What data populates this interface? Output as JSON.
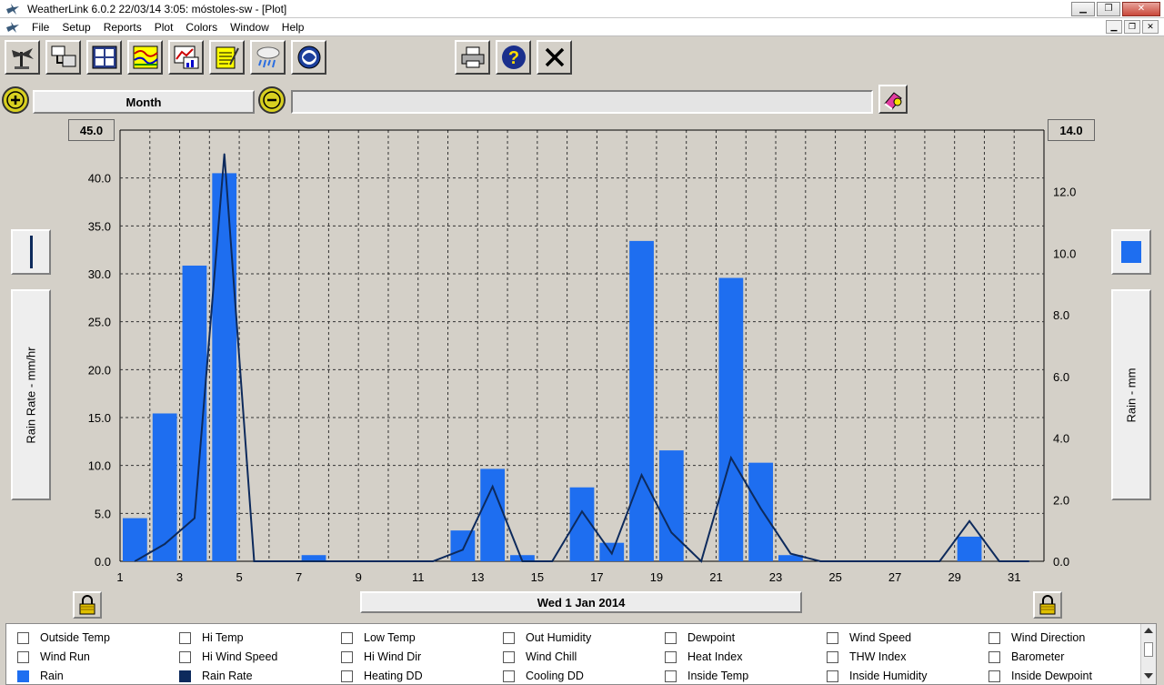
{
  "window": {
    "title": "WeatherLink 6.0.2  22/03/14   3:05: móstoles-sw - [Plot]",
    "minimize": "▁",
    "restore": "❐",
    "close": "✕"
  },
  "menu": {
    "items": [
      "File",
      "Setup",
      "Reports",
      "Plot",
      "Colors",
      "Window",
      "Help"
    ]
  },
  "range": {
    "period": "Month",
    "secondary": ""
  },
  "axes": {
    "left_label": "Rain Rate - mm/hr",
    "right_label": "Rain - mm",
    "left_max": "45.0",
    "right_max": "14.0",
    "left_ticks": [
      "40.0",
      "35.0",
      "30.0",
      "25.0",
      "20.0",
      "15.0",
      "10.0",
      "5.0",
      "0.0"
    ],
    "right_ticks": [
      "12.0",
      "10.0",
      "8.0",
      "6.0",
      "4.0",
      "2.0",
      "0.0"
    ],
    "x_ticks": [
      "1",
      "3",
      "5",
      "7",
      "9",
      "11",
      "13",
      "15",
      "17",
      "19",
      "21",
      "23",
      "25",
      "27",
      "29",
      "31"
    ]
  },
  "date_label": "Wed 1 Jan 2014",
  "legend": {
    "rows": [
      [
        "Outside Temp",
        "Hi Temp",
        "Low Temp",
        "Out Humidity",
        "Dewpoint",
        "Wind Speed",
        "Wind Direction"
      ],
      [
        "Wind Run",
        "Hi Wind Speed",
        "Hi Wind Dir",
        "Wind Chill",
        "Heat Index",
        "THW Index",
        "Barometer"
      ],
      [
        "Rain",
        "Rain Rate",
        "Heating DD",
        "Cooling DD",
        "Inside Temp",
        "Inside Humidity",
        "Inside Dewpoint"
      ]
    ],
    "checked": [
      "Rain",
      "Rain Rate"
    ]
  },
  "colors": {
    "rain_bar": "#1e6ef0",
    "rain_rate_line": "#0d2a5c",
    "plot_bg": "#d4d0c8",
    "grid": "#333333"
  },
  "chart_data": {
    "type": "bar",
    "x": [
      1,
      2,
      3,
      4,
      5,
      6,
      7,
      8,
      9,
      10,
      11,
      12,
      13,
      14,
      15,
      16,
      17,
      18,
      19,
      20,
      21,
      22,
      23,
      24,
      25,
      26,
      27,
      28,
      29,
      30,
      31
    ],
    "xlim": [
      1,
      32
    ],
    "series": [
      {
        "name": "Rain",
        "axis": "right",
        "kind": "bar",
        "values": [
          1.4,
          4.8,
          9.6,
          12.6,
          0,
          0,
          0.2,
          0,
          0,
          0,
          0,
          1.0,
          3.0,
          0.2,
          0,
          2.4,
          0.6,
          10.4,
          3.6,
          0,
          9.2,
          3.2,
          0.2,
          0,
          0,
          0,
          0,
          0,
          0.8,
          0,
          0
        ]
      },
      {
        "name": "Rain Rate",
        "axis": "left",
        "kind": "line",
        "x": [
          1.5,
          2.5,
          3.5,
          4.5,
          5.5,
          6.5,
          7.5,
          8.5,
          9.5,
          10.5,
          11.5,
          12.5,
          13.5,
          14.5,
          15.5,
          16.5,
          17.5,
          18.5,
          19.5,
          20.5,
          21.5,
          22.5,
          23.5,
          24.5,
          25.5,
          26.5,
          27.5,
          28.5,
          29.5,
          30.5,
          31.5
        ],
        "values": [
          0,
          1.8,
          4.5,
          42.5,
          0,
          0,
          0,
          0,
          0,
          0,
          0,
          1.2,
          7.8,
          0,
          0,
          5.2,
          0.8,
          9.0,
          3.0,
          0,
          10.8,
          5.5,
          0.8,
          0,
          0,
          0,
          0,
          0,
          4.2,
          0,
          0
        ]
      }
    ],
    "ylim_left": [
      0,
      45
    ],
    "ylim_right": [
      0,
      14
    ],
    "ylabel_left": "Rain Rate - mm/hr",
    "ylabel_right": "Rain - mm",
    "xlabel": "Wed 1 Jan 2014",
    "grid": true
  }
}
